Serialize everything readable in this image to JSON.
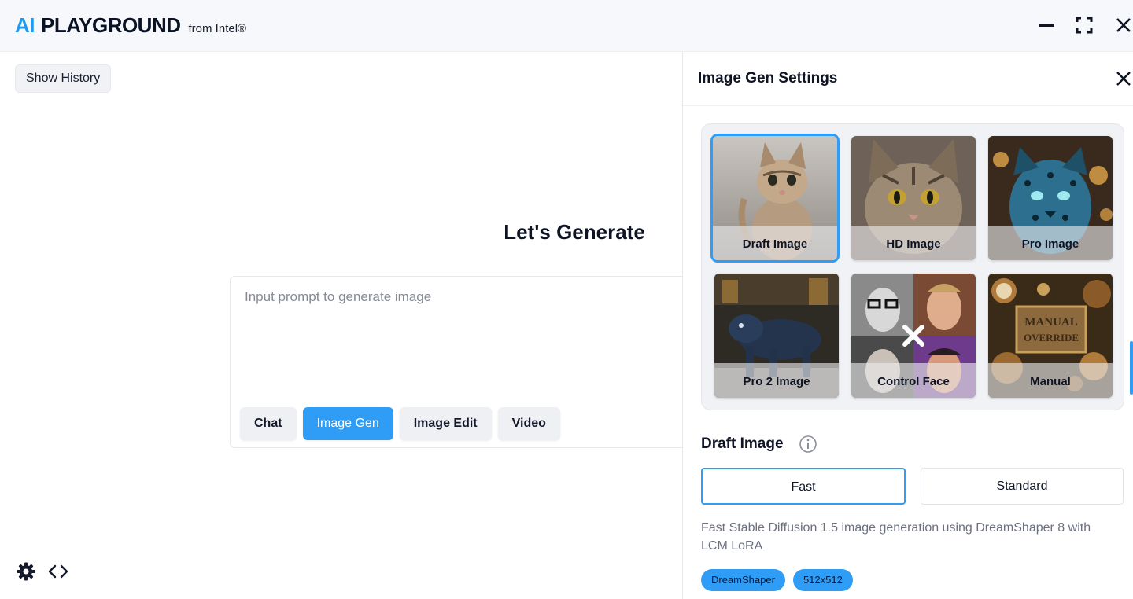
{
  "app": {
    "brand_ai": "AI",
    "brand_name": "PLAYGROUND",
    "brand_sub": "from Intel®"
  },
  "sidebar": {
    "show_history_label": "Show History"
  },
  "main": {
    "headline": "Let's Generate",
    "prompt_placeholder": "Input prompt to generate image",
    "prompt_value": "",
    "tabs": [
      {
        "label": "Chat",
        "active": false
      },
      {
        "label": "Image Gen",
        "active": true
      },
      {
        "label": "Image Edit",
        "active": false
      },
      {
        "label": "Video",
        "active": false
      }
    ]
  },
  "bottom_icons": [
    "gear-icon",
    "code-icon"
  ],
  "panel": {
    "title": "Image Gen Settings",
    "presets": [
      {
        "label": "Draft Image",
        "selected": true,
        "thumbnail": "kitten"
      },
      {
        "label": "HD Image",
        "selected": false,
        "thumbnail": "tabby-cat"
      },
      {
        "label": "Pro Image",
        "selected": false,
        "thumbnail": "blue-leopard"
      },
      {
        "label": "Pro 2 Image",
        "selected": false,
        "thumbnail": "dark-panther"
      },
      {
        "label": "Control Face",
        "selected": false,
        "thumbnail": "face-collage"
      },
      {
        "label": "Manual",
        "selected": false,
        "thumbnail": "steampunk-gauges"
      }
    ],
    "selected_preset_title": "Draft Image",
    "speed_options": [
      {
        "label": "Fast",
        "selected": true
      },
      {
        "label": "Standard",
        "selected": false
      }
    ],
    "description": "Fast Stable Diffusion 1.5 image generation using DreamShaper 8 with LCM LoRA",
    "tags": [
      "DreamShaper",
      "512x512"
    ]
  },
  "colors": {
    "accent": "#2f9cf6",
    "brand_blue": "#1e9bf0",
    "text_dark": "#0f1424"
  }
}
